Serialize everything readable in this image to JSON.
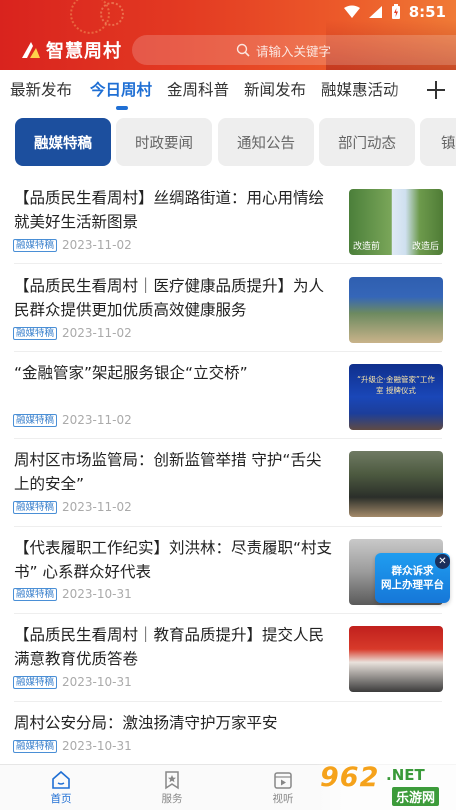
{
  "status_bar": {
    "time": "8:51"
  },
  "header": {
    "app_name": "智慧周村",
    "search_placeholder": "请输入关键字"
  },
  "channel_tabs": [
    {
      "label": "最新发布",
      "active": false
    },
    {
      "label": "今日周村",
      "active": true
    },
    {
      "label": "金周科普",
      "active": false
    },
    {
      "label": "新闻发布",
      "active": false
    },
    {
      "label": "融媒惠活动",
      "active": false
    }
  ],
  "sub_tabs": [
    {
      "label": "融媒特稿",
      "active": true
    },
    {
      "label": "时政要闻",
      "active": false
    },
    {
      "label": "通知公告",
      "active": false
    },
    {
      "label": "部门动态",
      "active": false
    },
    {
      "label": "镇",
      "active": false
    }
  ],
  "feed": [
    {
      "title": "【品质民生看周村】丝绸路街道：用心用情绘就美好生活新图景",
      "tag": "融媒特稿",
      "date": "2023-11-02",
      "thumb_labels": [
        "改造前",
        "改造后"
      ]
    },
    {
      "title": "【品质民生看周村｜医疗健康品质提升】为人民群众提供更加优质高效健康服务",
      "tag": "融媒特稿",
      "date": "2023-11-02"
    },
    {
      "title": "“金融管家”架起服务银企“立交桥”",
      "tag": "融媒特稿",
      "date": "2023-11-02",
      "thumb_banner": "“升级企·金融管家”工作室  授牌仪式"
    },
    {
      "title": "周村区市场监管局：创新监管举措  守护“舌尖上的安全”",
      "tag": "融媒特稿",
      "date": "2023-11-02"
    },
    {
      "title": "【代表履职工作纪实】刘洪林：尽责履职“村支书”  心系群众好代表",
      "tag": "融媒特稿",
      "date": "2023-10-31"
    },
    {
      "title": "【品质民生看周村｜教育品质提升】提交人民满意教育优质答卷",
      "tag": "融媒特稿",
      "date": "2023-10-31"
    },
    {
      "title": "周村公安分局：激浊扬清守护万家平安",
      "tag": "融媒特稿",
      "date": "2023-10-31"
    }
  ],
  "float_badge": {
    "line1": "群众诉求",
    "line2": "网上办理平台"
  },
  "bottom_nav": [
    {
      "label": "首页",
      "active": true
    },
    {
      "label": "服务",
      "active": false
    },
    {
      "label": "视听",
      "active": false
    }
  ],
  "watermark": {
    "number": "962",
    "suffix": ".NET",
    "cn": "乐游网"
  },
  "colors": {
    "header_red": "#d9231e",
    "accent_blue": "#1f6fd4",
    "pill_active": "#1c4f9e",
    "tag_blue": "#3a80cc"
  }
}
